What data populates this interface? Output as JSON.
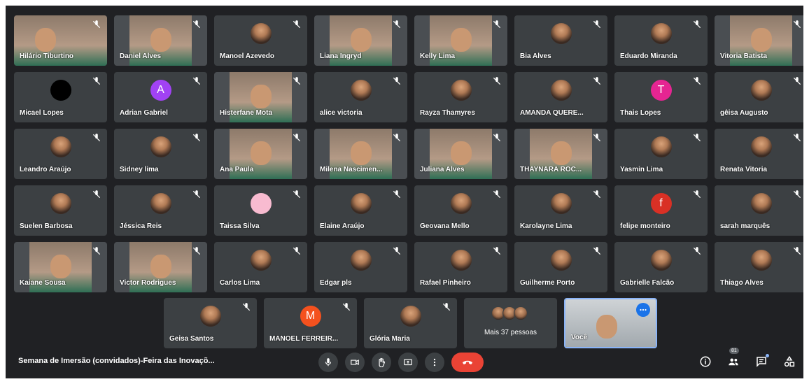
{
  "grid_tiles": [
    {
      "name": "Hilário Tiburtino",
      "kind": "video-wide"
    },
    {
      "name": "Daniel Alves",
      "kind": "video"
    },
    {
      "name": "Manoel Azevedo",
      "kind": "photo"
    },
    {
      "name": "Liana Ingryd",
      "kind": "video"
    },
    {
      "name": "Kelly Lima",
      "kind": "video"
    },
    {
      "name": "Bia Alves",
      "kind": "photo"
    },
    {
      "name": "Eduardo Miranda",
      "kind": "photo"
    },
    {
      "name": "Vitoria Batista",
      "kind": "video"
    },
    {
      "name": "Micael Lopes",
      "kind": "photo-black"
    },
    {
      "name": "Adrian Gabriel",
      "kind": "initial",
      "initial": "A",
      "color": "#a142f4"
    },
    {
      "name": "Histerfane Mota",
      "kind": "video"
    },
    {
      "name": "alice victoria",
      "kind": "photo"
    },
    {
      "name": "Rayza Thamyres",
      "kind": "photo"
    },
    {
      "name": "AMANDA QUERE...",
      "kind": "photo"
    },
    {
      "name": "Thais Lopes",
      "kind": "initial",
      "initial": "T",
      "color": "#e52592"
    },
    {
      "name": "gêisa Augusto",
      "kind": "photo"
    },
    {
      "name": "Leandro Araújo",
      "kind": "photo"
    },
    {
      "name": "Sidney lima",
      "kind": "photo"
    },
    {
      "name": "Ana Paula",
      "kind": "video"
    },
    {
      "name": "Milena Nascimen...",
      "kind": "video"
    },
    {
      "name": "Juliana Alves",
      "kind": "video"
    },
    {
      "name": "THAYNARA ROC...",
      "kind": "video"
    },
    {
      "name": "Yasmin Lima",
      "kind": "photo"
    },
    {
      "name": "Renata Vitoria",
      "kind": "photo"
    },
    {
      "name": "Suelen Barbosa",
      "kind": "photo"
    },
    {
      "name": "Jéssica Reis",
      "kind": "photo"
    },
    {
      "name": "Taissa Silva",
      "kind": "initial",
      "initial": "",
      "color": "#f8bbd0"
    },
    {
      "name": "Elaine Araújo",
      "kind": "photo"
    },
    {
      "name": "Geovana Mello",
      "kind": "photo"
    },
    {
      "name": "Karolayne Lima",
      "kind": "photo"
    },
    {
      "name": "felipe monteiro",
      "kind": "initial",
      "initial": "f",
      "color": "#d93025"
    },
    {
      "name": "sarah marquês",
      "kind": "photo"
    },
    {
      "name": "Kaiane Sousa",
      "kind": "video"
    },
    {
      "name": "Victor Rodrigues",
      "kind": "video"
    },
    {
      "name": "Carlos Lima",
      "kind": "photo"
    },
    {
      "name": "Edgar pls",
      "kind": "photo"
    },
    {
      "name": "Rafael Pinheiro",
      "kind": "photo"
    },
    {
      "name": "Guilherme Porto",
      "kind": "photo"
    },
    {
      "name": "Gabrielle Falcão",
      "kind": "photo"
    },
    {
      "name": "Thiago Alves",
      "kind": "photo"
    }
  ],
  "bottom_tiles": {
    "t1": {
      "name": "Geisa Santos"
    },
    "t2": {
      "name": "MANOEL FERREIR...",
      "initial": "M",
      "color": "#f4511e"
    },
    "t3": {
      "name": "Glória Maria"
    },
    "more": {
      "label": "Mais 37 pessoas"
    },
    "self": {
      "name": "Você"
    }
  },
  "toolbar": {
    "meeting_title": "Semana de Imersão (convidados)-Feira das Inovaçõ...",
    "people_count": "81"
  },
  "colors": {
    "accent": "#1a73e8",
    "end_call": "#ea4335",
    "tile_bg": "#3c4043",
    "meeting_bg": "#202124"
  }
}
